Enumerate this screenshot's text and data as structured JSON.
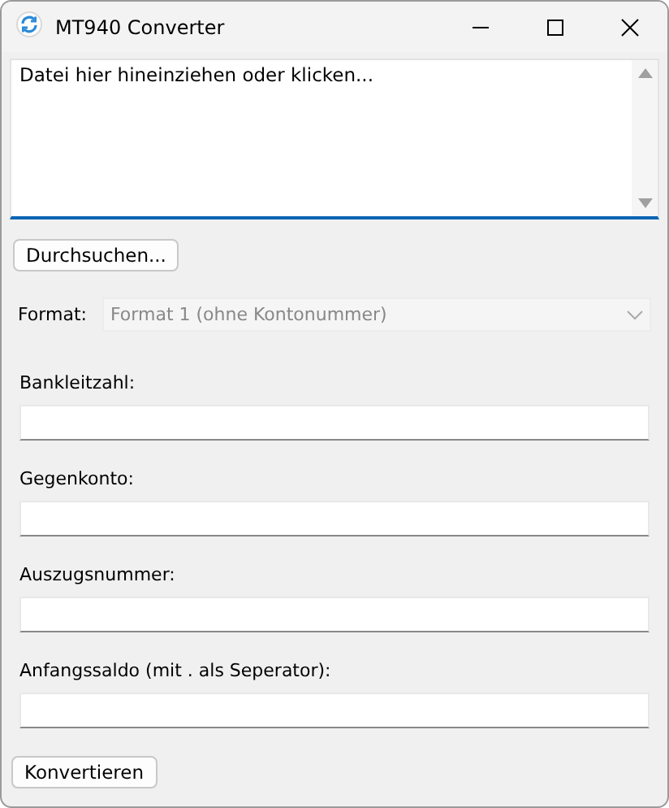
{
  "window": {
    "title": "MT940 Converter"
  },
  "drop_area": {
    "value": "Datei hier hineinziehen oder klicken...",
    "focused": true
  },
  "browse_button": {
    "label": "Durchsuchen..."
  },
  "format": {
    "label": "Format:",
    "value": "Format 1 (ohne Kontonummer)",
    "disabled": true
  },
  "fields": [
    {
      "label": "Bankleitzahl:"
    },
    {
      "label": "Gegenkonto:"
    },
    {
      "label": "Auszugsnummer:"
    },
    {
      "label": "Anfangssaldo (mit . als Seperator):"
    }
  ],
  "convert_button": {
    "label": "Konvertieren"
  }
}
